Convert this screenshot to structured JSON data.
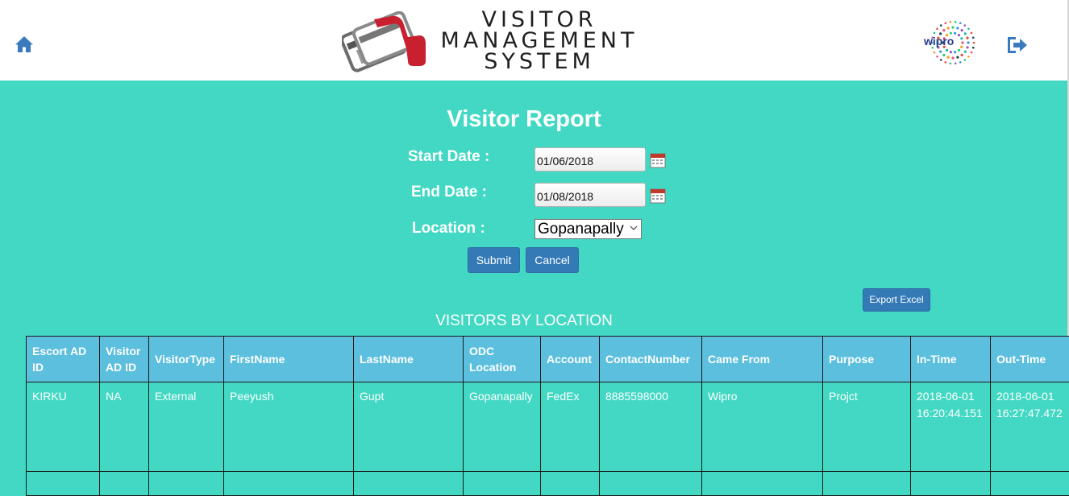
{
  "header": {
    "logo_lines": [
      "VISITOR",
      "MANAGEMENT",
      "SYSTEM"
    ],
    "brand_logo_text": "wipro"
  },
  "page": {
    "title": "Visitor Report"
  },
  "form": {
    "start_date_label": "Start Date :",
    "start_date_value": "01/06/2018",
    "end_date_label": "End Date :",
    "end_date_value": "01/08/2018",
    "location_label": "Location :",
    "location_value": "Gopanapally",
    "submit_label": "Submit",
    "cancel_label": "Cancel"
  },
  "export_label": "Export Excel",
  "section_title": "VISITORS BY LOCATION",
  "table": {
    "headers": [
      "Escort AD ID",
      "Visitor AD ID",
      "VisitorType",
      "FirstName",
      "LastName",
      "ODC Location",
      "Account",
      "ContactNumber",
      "Came From",
      "Purpose",
      "In-Time",
      "Out-Time"
    ],
    "rows": [
      [
        "KIRKU",
        "NA",
        "External",
        "Peeyush",
        "Gupt",
        "Gopanapally",
        "FedEx",
        "8885598000",
        "Wipro",
        "Projct",
        "2018-06-01 16:20:44.151",
        "2018-06-01 16:27:47.472"
      ]
    ]
  },
  "colors": {
    "background": "#42d8c3",
    "header_bg": "#ffffff",
    "table_header_bg": "#5bbfdd",
    "button_bg": "#337ab7",
    "icon_blue": "#3a7bc0"
  }
}
